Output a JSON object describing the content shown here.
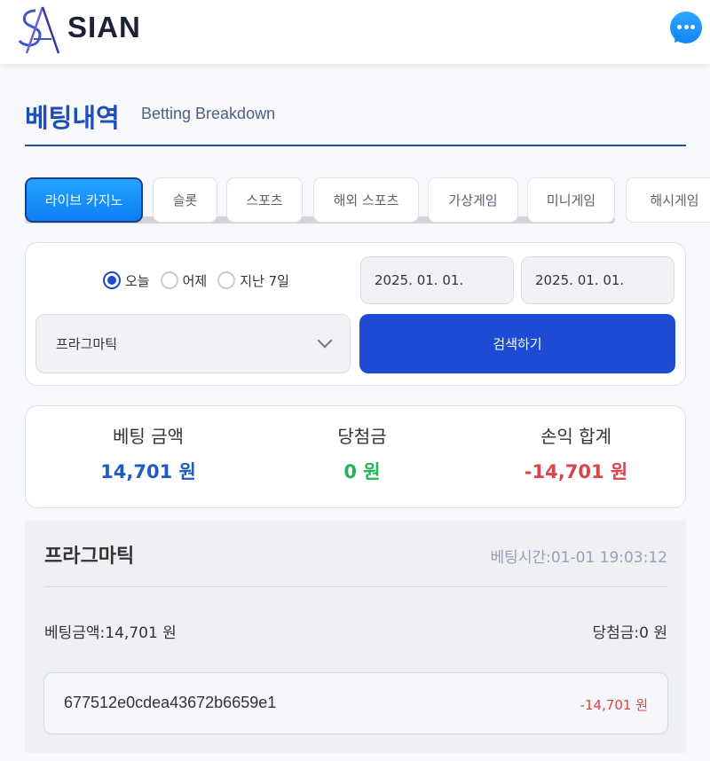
{
  "header": {
    "logo_text": "SIAN",
    "logo_mark": "S/A monogram logo",
    "chat_icon": "chat-bubble-icon",
    "brand_color": "#1e4bd4"
  },
  "page": {
    "title": "베팅내역",
    "subtitle": "Betting Breakdown"
  },
  "tabs": [
    {
      "label": "라이브 카지노",
      "active": true
    },
    {
      "label": "슬롯",
      "active": false
    },
    {
      "label": "스포츠",
      "active": false
    },
    {
      "label": "해외 스포츠",
      "active": false
    },
    {
      "label": "가상게임",
      "active": false
    },
    {
      "label": "미니게임",
      "active": false
    },
    {
      "label": "해시게임",
      "active": false
    }
  ],
  "filter": {
    "periods": [
      {
        "label": "오늘",
        "checked": true
      },
      {
        "label": "어제",
        "checked": false
      },
      {
        "label": "지난 7일",
        "checked": false
      }
    ],
    "date_from": "2025. 01. 01.",
    "date_to": "2025. 01. 01.",
    "provider_selected": "프라그마틱",
    "search_label": "검색하기"
  },
  "summary": {
    "bet_label": "베팅 금액",
    "bet_value": "14,701 원",
    "win_label": "당첨금",
    "win_value": "0 원",
    "profit_label": "손익 합계",
    "profit_value": "-14,701 원"
  },
  "records": [
    {
      "provider": "프라그마틱",
      "time": "베팅시간:01-01 19:03:12",
      "bet": "베팅금액:14,701 원",
      "win": "당첨금:0 원",
      "hash": "677512e0cdea43672b6659e1",
      "amount": "-14,701 원"
    }
  ]
}
